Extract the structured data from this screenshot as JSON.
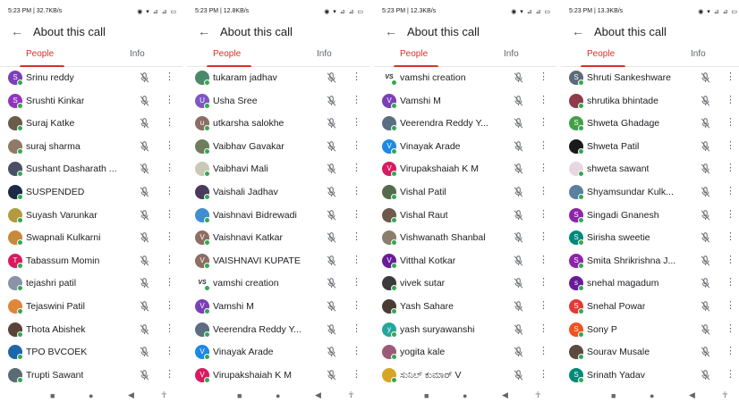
{
  "panels": [
    {
      "status": {
        "time": "5:23 PM | 32.7KB/s",
        "icons": "◉ ▾ ⊿ ⊿ ▭"
      },
      "header": {
        "back_icon": "arrow-back-icon",
        "title": "About this call"
      },
      "tabs": {
        "people": "People",
        "info": "Info"
      },
      "participants": [
        {
          "name": "Srinu reddy",
          "initial": "S",
          "color": "#7b3fb6"
        },
        {
          "name": "Srushti Kinkar",
          "initial": "S",
          "color": "#9334c0"
        },
        {
          "name": "Suraj Katke",
          "initial": "",
          "color": "#6b5b4b"
        },
        {
          "name": "suraj sharma",
          "initial": "",
          "color": "#8f7a68"
        },
        {
          "name": "Sushant Dasharath ...",
          "initial": "",
          "color": "#4a4e66"
        },
        {
          "name": "SUSPENDED",
          "initial": "",
          "color": "#1c2a44"
        },
        {
          "name": "Suyash Varunkar",
          "initial": "",
          "color": "#b49a3e"
        },
        {
          "name": "Swapnali Kulkarni",
          "initial": "",
          "color": "#c7893c"
        },
        {
          "name": "Tabassum Momin",
          "initial": "T",
          "color": "#d81b60"
        },
        {
          "name": "tejashri patil",
          "initial": "",
          "color": "#8a93a8"
        },
        {
          "name": "Tejaswini Patil",
          "initial": "",
          "color": "#e0863a"
        },
        {
          "name": "Thota Abishek",
          "initial": "",
          "color": "#5a4338"
        },
        {
          "name": "TPO BVCOEK",
          "initial": "",
          "color": "#1f66a8"
        },
        {
          "name": "Trupti Sawant",
          "initial": "",
          "color": "#5b6b73"
        }
      ]
    },
    {
      "status": {
        "time": "5:23 PM | 12.8KB/s",
        "icons": "◉ ▾ ⊿ ⊿ ▭"
      },
      "header": {
        "back_icon": "arrow-back-icon",
        "title": "About this call"
      },
      "tabs": {
        "people": "People",
        "info": "Info"
      },
      "participants": [
        {
          "name": "tukaram jadhav",
          "initial": "",
          "color": "#4a8a6a"
        },
        {
          "name": "Usha Sree",
          "initial": "U",
          "color": "#7e57c2"
        },
        {
          "name": "utkarsha salokhe",
          "initial": "u",
          "color": "#8d6e63"
        },
        {
          "name": "Vaibhav Gavakar",
          "initial": "",
          "color": "#6f7d5b"
        },
        {
          "name": "Vaibhavi Mali",
          "initial": "",
          "color": "#c9c9b5"
        },
        {
          "name": "Vaishali Jadhav",
          "initial": "",
          "color": "#4b3a5e"
        },
        {
          "name": "Vaishnavi Bidrewadi",
          "initial": "",
          "color": "#3f8fd0"
        },
        {
          "name": "Vaishnavi Katkar",
          "initial": "V",
          "color": "#8d6e63"
        },
        {
          "name": "VAISHNAVI KUPATE",
          "initial": "V",
          "color": "#8d6e63"
        },
        {
          "name": "vamshi creation",
          "initial": "VS",
          "color": "#ffffff"
        },
        {
          "name": "Vamshi M",
          "initial": "V",
          "color": "#7b3fb6"
        },
        {
          "name": "Veerendra Reddy Y...",
          "initial": "",
          "color": "#5b6e82"
        },
        {
          "name": "Vinayak Arade",
          "initial": "V",
          "color": "#1e88e5"
        },
        {
          "name": "Virupakshaiah K M",
          "initial": "V",
          "color": "#d81b60"
        }
      ]
    },
    {
      "status": {
        "time": "5:23 PM | 12.3KB/s",
        "icons": "◉ ▾ ⊿ ⊿ ▭"
      },
      "header": {
        "back_icon": "arrow-back-icon",
        "title": "About this call"
      },
      "tabs": {
        "people": "People",
        "info": "Info"
      },
      "participants": [
        {
          "name": "vamshi creation",
          "initial": "VS",
          "color": "#ffffff"
        },
        {
          "name": "Vamshi M",
          "initial": "V",
          "color": "#7b3fb6"
        },
        {
          "name": "Veerendra Reddy Y...",
          "initial": "",
          "color": "#5b6e82"
        },
        {
          "name": "Vinayak Arade",
          "initial": "V",
          "color": "#1e88e5"
        },
        {
          "name": "Virupakshaiah K M",
          "initial": "V",
          "color": "#d81b60"
        },
        {
          "name": "Vishal Patil",
          "initial": "",
          "color": "#556b4f"
        },
        {
          "name": "Vishal Raut",
          "initial": "",
          "color": "#6d5a4a"
        },
        {
          "name": "Vishwanath Shanbal",
          "initial": "",
          "color": "#8a7f6a"
        },
        {
          "name": "Vitthal Kotkar",
          "initial": "V",
          "color": "#6a1b9a"
        },
        {
          "name": "vivek sutar",
          "initial": "",
          "color": "#3b3b3b"
        },
        {
          "name": "Yash Sahare",
          "initial": "",
          "color": "#4a3c35"
        },
        {
          "name": "yash suryawanshi",
          "initial": "y",
          "color": "#26a69a"
        },
        {
          "name": "yogita kale",
          "initial": "",
          "color": "#9c5a7a"
        },
        {
          "name": "ಸುನಿಲ್ ಕುಮಾರ್ V",
          "initial": "",
          "color": "#d6a526"
        }
      ]
    },
    {
      "status": {
        "time": "5:23 PM | 13.3KB/s",
        "icons": "◉ ▾ ⊿ ⊿ ▭"
      },
      "header": {
        "back_icon": "arrow-back-icon",
        "title": "About this call"
      },
      "tabs": {
        "people": "People",
        "info": "Info"
      },
      "participants": [
        {
          "name": "Shruti Sankeshware",
          "initial": "S",
          "color": "#5c6b7a"
        },
        {
          "name": "shrutika bhintade",
          "initial": "",
          "color": "#8e3b4a"
        },
        {
          "name": "Shweta Ghadage",
          "initial": "S",
          "color": "#43a047"
        },
        {
          "name": "Shweta Patil",
          "initial": "",
          "color": "#1a1a1a"
        },
        {
          "name": "shweta sawant",
          "initial": "",
          "color": "#e8d6e0"
        },
        {
          "name": "Shyamsundar Kulk...",
          "initial": "",
          "color": "#5a7fa0"
        },
        {
          "name": "Singadi Gnanesh",
          "initial": "S",
          "color": "#8e24aa"
        },
        {
          "name": "Sirisha sweetie",
          "initial": "S",
          "color": "#00897b"
        },
        {
          "name": "Smita Shrikrishna J...",
          "initial": "S",
          "color": "#8e24aa"
        },
        {
          "name": "snehal magadum",
          "initial": "s",
          "color": "#6a1b9a"
        },
        {
          "name": "Snehal Powar",
          "initial": "S",
          "color": "#e53935"
        },
        {
          "name": "Sony P",
          "initial": "S",
          "color": "#f4511e"
        },
        {
          "name": "Sourav Musale",
          "initial": "",
          "color": "#5d4a3f"
        },
        {
          "name": "Srinath Yadav",
          "initial": "S",
          "color": "#00897b"
        }
      ]
    }
  ],
  "nav": {
    "square": "■",
    "circle": "●",
    "triangle": "◀",
    "accessibility": "☥"
  }
}
